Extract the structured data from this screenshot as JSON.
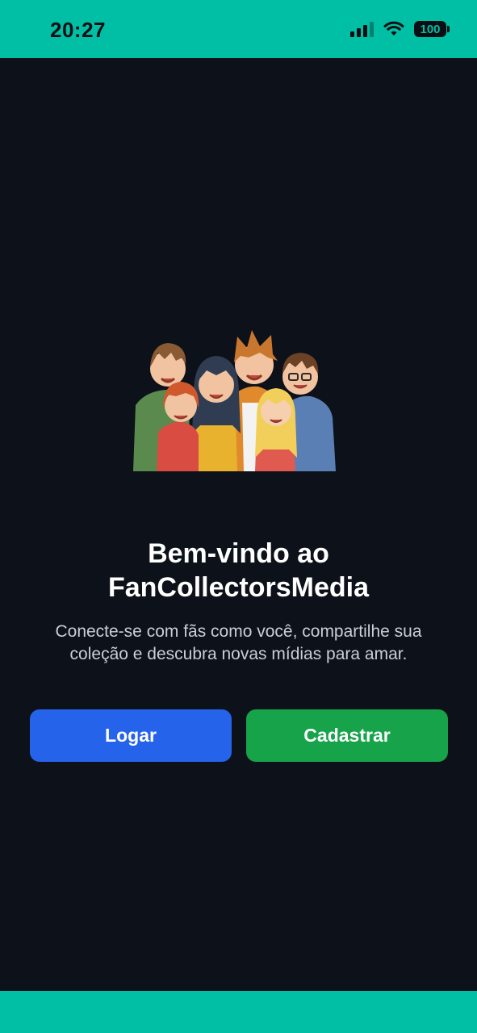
{
  "status_bar": {
    "time": "20:27",
    "battery": "100",
    "icons": [
      "signal-icon",
      "wifi-icon",
      "battery-icon"
    ]
  },
  "welcome": {
    "title_line1": "Bem-vindo ao",
    "title_line2": "FanCollectorsMedia",
    "subtitle": "Conecte-se com fãs como você, compartilhe sua coleção e descubra novas mídias para amar."
  },
  "actions": {
    "login_label": "Logar",
    "signup_label": "Cadastrar"
  },
  "colors": {
    "accent": "#00bfa5",
    "background": "#0d1119",
    "login_button": "#2563eb",
    "signup_button": "#16a34a"
  }
}
